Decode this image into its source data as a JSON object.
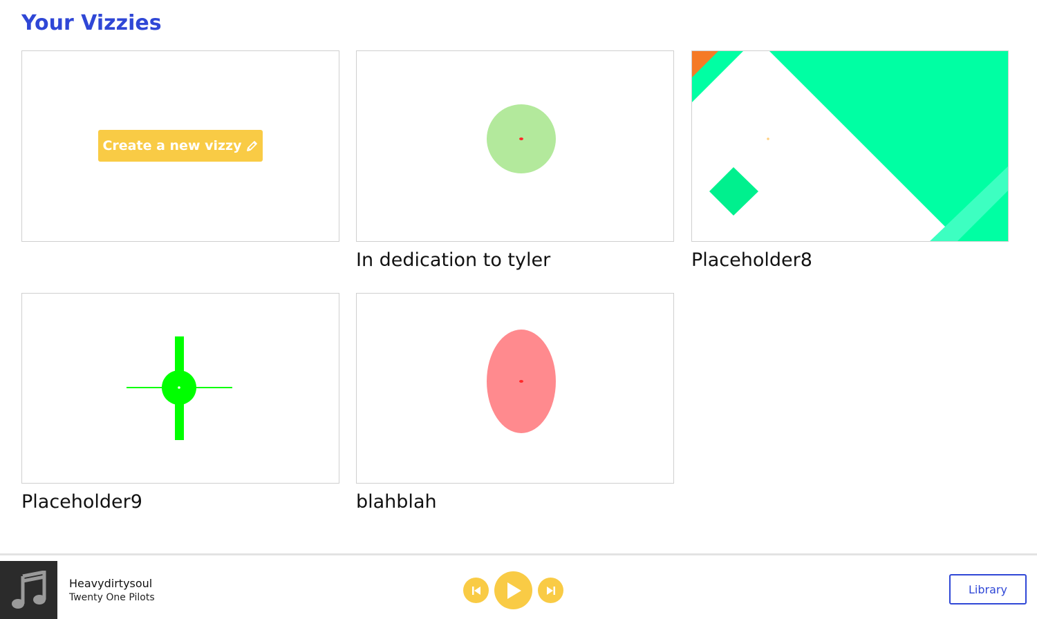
{
  "header": {
    "title": "Your Vizzies"
  },
  "create_card": {
    "button_label": "Create a new vizzy",
    "icon": "pencil-icon"
  },
  "vizzies": [
    {
      "title": "In dedication to tyler"
    },
    {
      "title": "Placeholder8"
    },
    {
      "title": "Placeholder9"
    },
    {
      "title": "blahblah"
    }
  ],
  "player": {
    "track_title": "Heavydirtysoul",
    "artist": "Twenty One Pilots",
    "album_icon": "music-note-icon",
    "controls": [
      "previous-icon",
      "play-icon",
      "next-icon"
    ],
    "library_label": "Library"
  },
  "colors": {
    "brand_blue": "#2f47d6",
    "accent_yellow": "#f9cb45",
    "mint": "#00ffa3",
    "light_green": "#b3e99c",
    "bright_green": "#00ff00",
    "pink": "#ff8a8e",
    "orange": "#f57a26"
  }
}
